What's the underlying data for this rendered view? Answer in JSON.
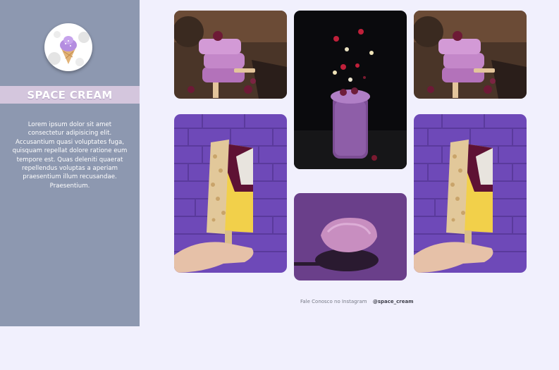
{
  "brand": {
    "title": "SPACE CREAM",
    "logo_icon": "ice-cream-cone-icon"
  },
  "sidebar": {
    "description": "Lorem ipsum dolor sit amet consectetur adipisicing elit. Accusantium quasi voluptates fuga, quisquam repellat dolore ratione eum tempore est. Quas deleniti quaerat repellendus voluptas a aperiam praesentium illum recusandae. Praesentium."
  },
  "gallery": [
    {
      "name": "photo-popsicle-stack-1",
      "subject": "stacked purple popsicles with raspberries"
    },
    {
      "name": "photo-smoothie-jar",
      "subject": "purple smoothie jar with floating fruit"
    },
    {
      "name": "photo-popsicle-stack-2",
      "subject": "stacked purple popsicles with raspberries"
    },
    {
      "name": "photo-popsicle-hand-1",
      "subject": "popsicle held in hand against purple brick wall"
    },
    {
      "name": "photo-ice-cream-scoop",
      "subject": "scoop of purple ice cream"
    },
    {
      "name": "photo-popsicle-hand-2",
      "subject": "popsicle held in hand against purple brick wall"
    }
  ],
  "footer": {
    "label": "Fale Conosco no Instagram",
    "handle": "@space_cream"
  },
  "colors": {
    "sidebar": "#8d98b0",
    "brand_band": "#d4c6dd",
    "page_background": "#f1f0fd"
  }
}
